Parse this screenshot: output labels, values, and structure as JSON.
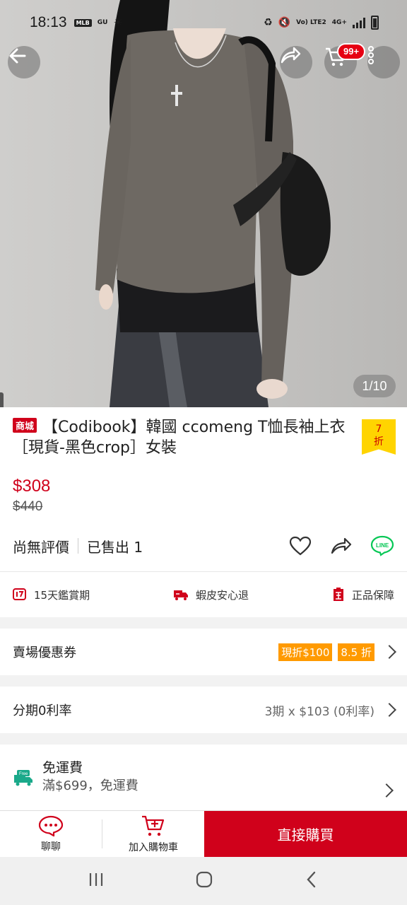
{
  "status_bar": {
    "time": "18:13",
    "left_tags": [
      "MLB",
      "GU"
    ],
    "volte": "Vo) LTE2",
    "network": "4G+"
  },
  "header": {
    "cart_badge": "99+",
    "image_counter": "1/10"
  },
  "product": {
    "mall_tag": "商城",
    "title": "【Codibook】韓國 ccomeng T恤長袖上衣［現貨-黑色crop］女裝",
    "discount_number": "7",
    "discount_unit": "折",
    "price": "$308",
    "original_price": "$440",
    "rating_text": "尚無評價",
    "sold_text": "已售出 1"
  },
  "guarantees": [
    {
      "label": "15天鑑賞期",
      "icon": "seven-day-icon"
    },
    {
      "label": "蝦皮安心退",
      "icon": "return-truck-icon"
    },
    {
      "label": "正品保障",
      "icon": "authentic-icon"
    }
  ],
  "coupon_row": {
    "label": "賣場優惠券",
    "coupon1": "現折$100",
    "coupon2": "8.5 折"
  },
  "installment_row": {
    "label": "分期0利率",
    "value": "3期 x $103 (0利率)"
  },
  "shipping": {
    "title": "免運費",
    "subtitle": "滿$699，免運費",
    "free_tag": "Free"
  },
  "bottom_bar": {
    "chat": "聊聊",
    "add_to_cart": "加入購物車",
    "buy_now": "直接購買"
  },
  "colors": {
    "brand_red": "#d0011b",
    "coupon_orange": "#ff9a00",
    "line_green": "#06c755"
  }
}
